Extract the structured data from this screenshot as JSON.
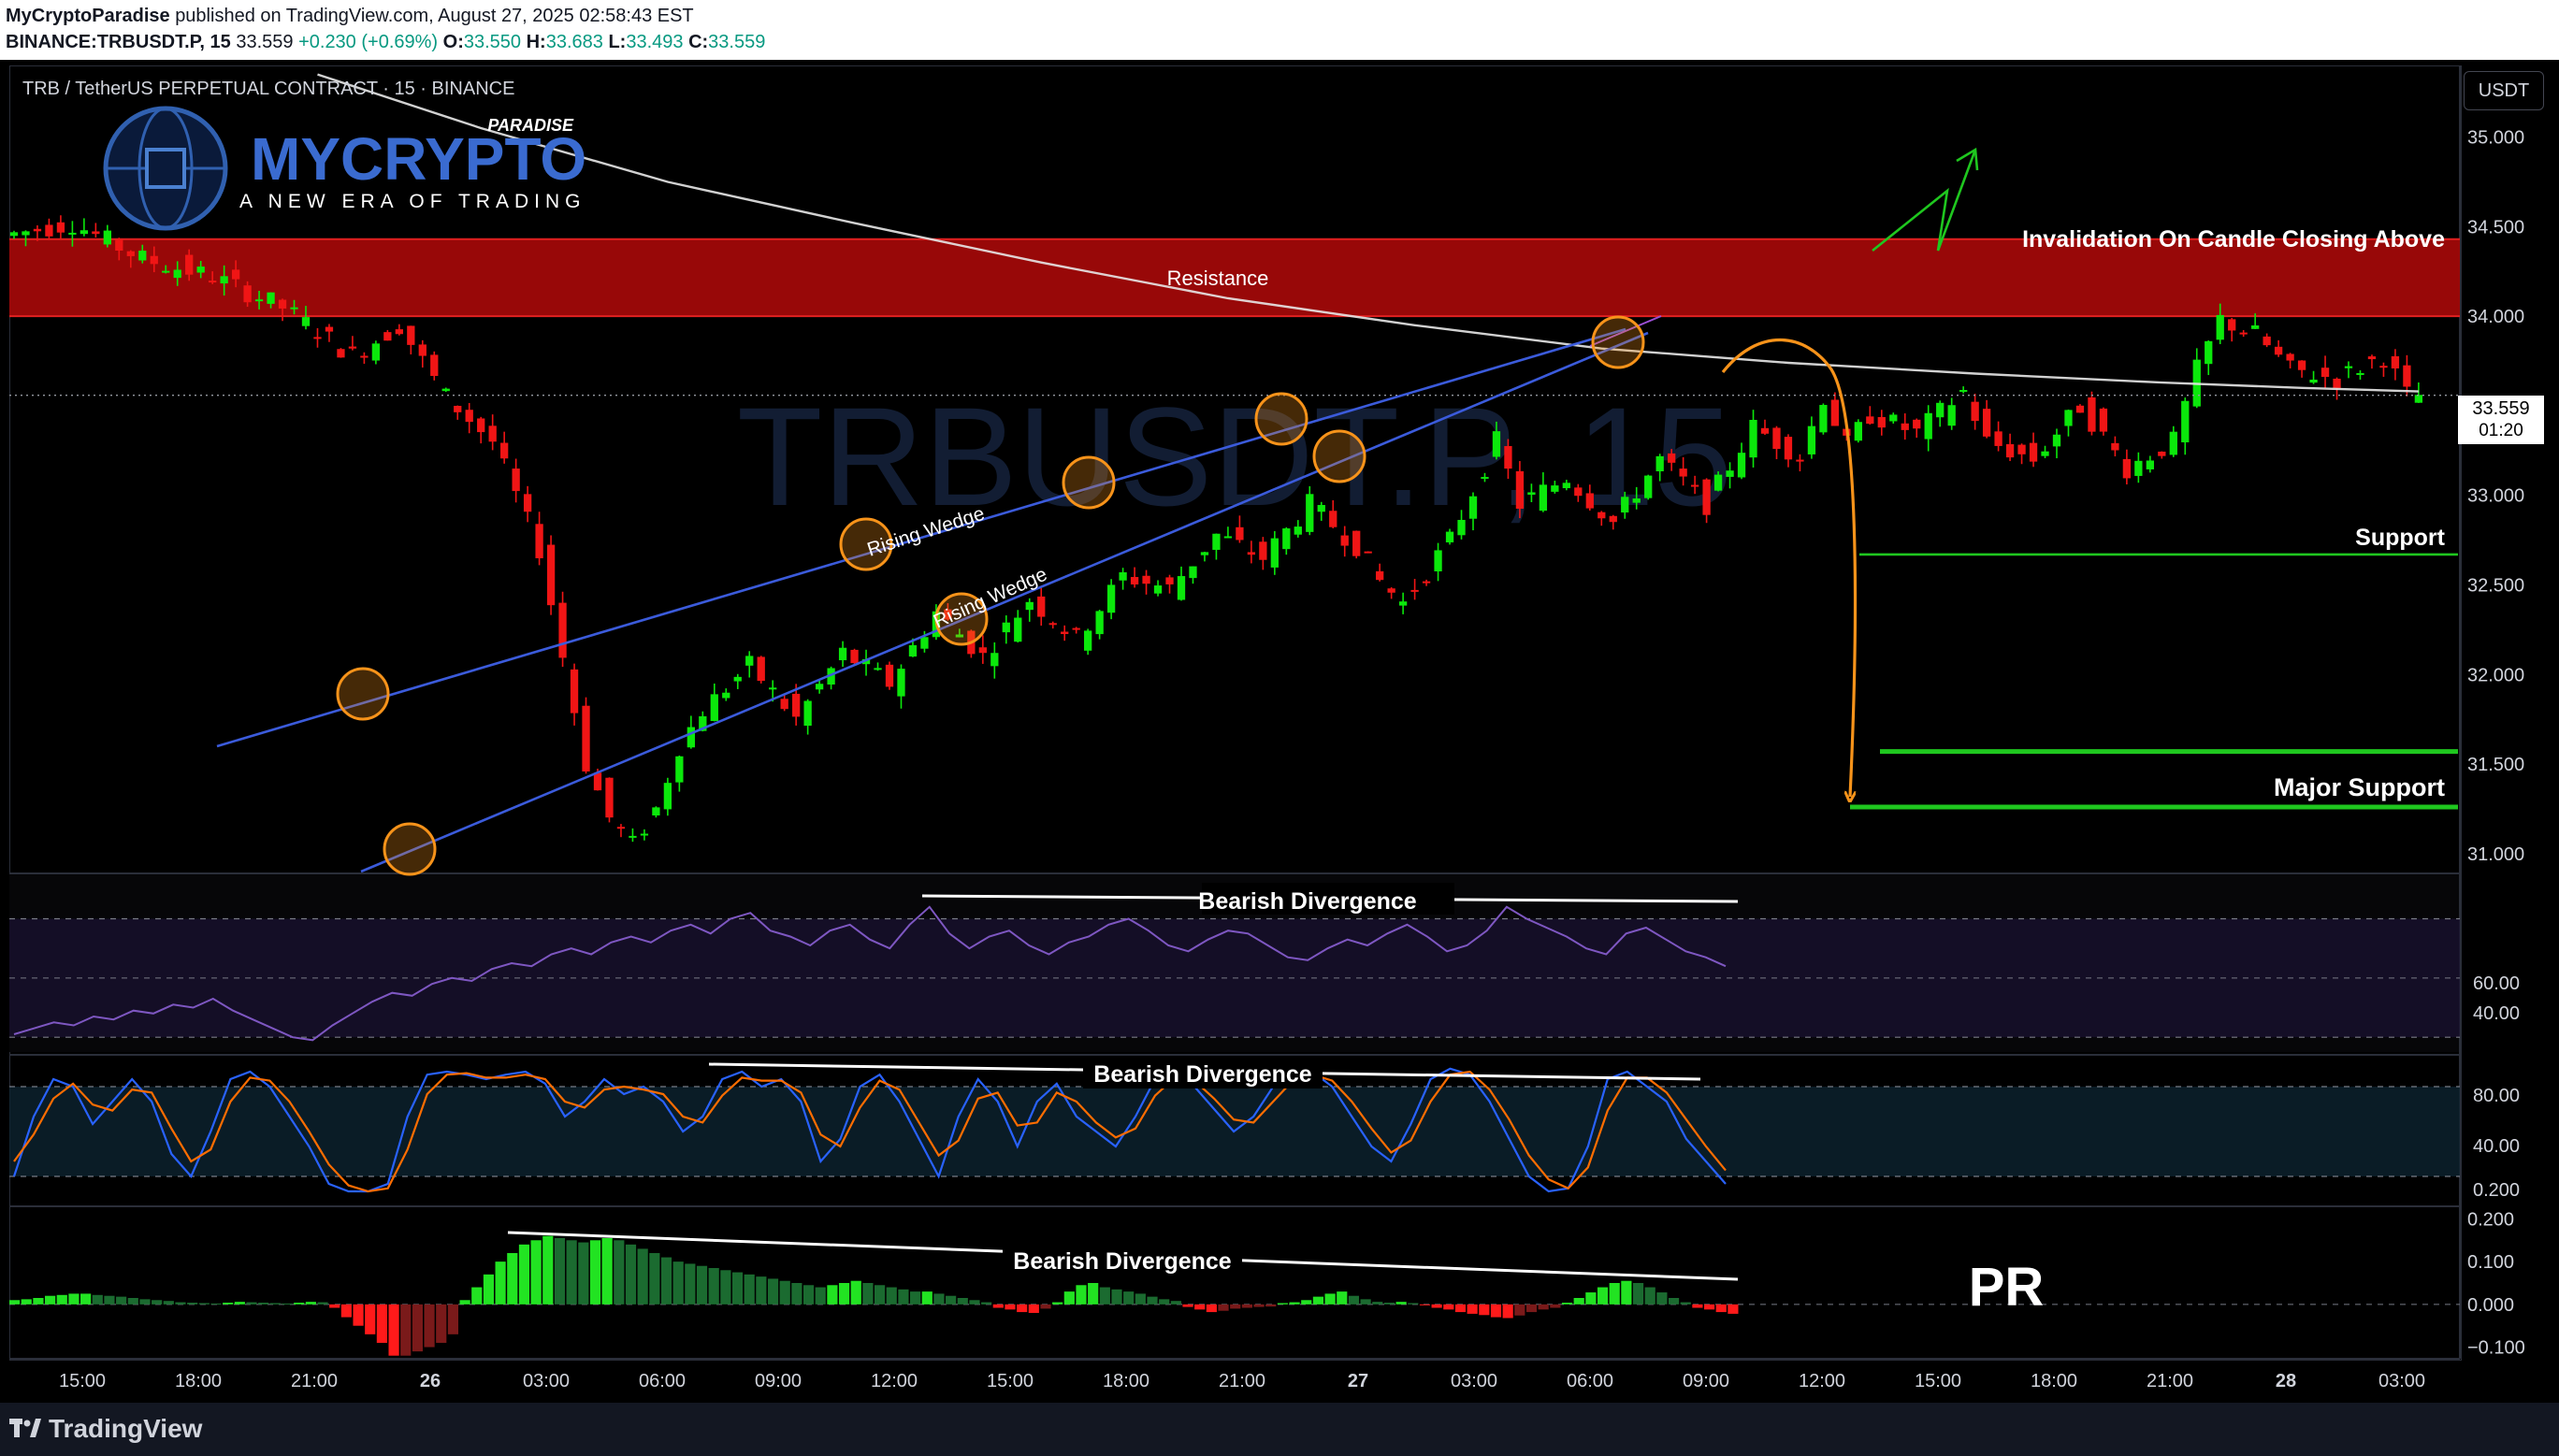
{
  "header": {
    "publisher": "MyCryptoParadise",
    "published_text": "published on TradingView.com, August 27, 2025 02:58:43 EST",
    "ticker": "BINANCE:TRBUSDT.P, 15",
    "last": "33.559",
    "change": "+0.230 (+0.69%)",
    "open_label": "O:",
    "open": "33.550",
    "high_label": "H:",
    "high": "33.683",
    "low_label": "L:",
    "low": "33.493",
    "close_label": "C:",
    "close": "33.559"
  },
  "symbol_title": "TRB / TetherUS PERPETUAL CONTRACT · 15 · BINANCE",
  "watermark": "TRBUSDT.P, 15",
  "currency_button": "USDT",
  "price_tag": {
    "price": "33.559",
    "countdown": "01:20"
  },
  "branding": {
    "logo_top": "PARADISE",
    "logo_main": "MYCRYPTO",
    "logo_tagline": "A NEW ERA OF TRADING",
    "corner_mark": "PR",
    "platform": "TradingView"
  },
  "colors": {
    "bullish": "#0be80b",
    "bearish": "#f01515",
    "resistance_zone": "#a00808",
    "trendline": "#3b5bdb",
    "projection_arrow": "#f7931a",
    "touch_circle": "#f7931a",
    "moving_average": "#e8e8e8",
    "support_line": "#1fc71f",
    "rsi": "#7e57c2",
    "stoch_k": "#2962ff",
    "stoch_d": "#ff6d00"
  },
  "chart_data": {
    "type": "candlestick",
    "instrument": "TRBUSDT.P",
    "timeframe": "15",
    "x_tick_labels": [
      "15:00",
      "18:00",
      "21:00",
      "26",
      "03:00",
      "06:00",
      "09:00",
      "12:00",
      "15:00",
      "18:00",
      "21:00",
      "27",
      "03:00",
      "06:00",
      "09:00",
      "12:00",
      "15:00",
      "18:00",
      "21:00",
      "28",
      "03:00"
    ],
    "y_tick_labels": [
      "35.000",
      "34.500",
      "34.000",
      "33.500",
      "33.000",
      "32.500",
      "32.000",
      "31.500",
      "31.000"
    ],
    "ylim": [
      30.9,
      35.4
    ],
    "grid": false,
    "ohlc_path": [
      [
        0,
        34.45
      ],
      [
        6,
        34.52
      ],
      [
        12,
        34.32
      ],
      [
        18,
        34.22
      ],
      [
        24,
        34.05
      ],
      [
        30,
        33.78
      ],
      [
        34,
        33.95
      ],
      [
        38,
        33.55
      ],
      [
        42,
        33.3
      ],
      [
        46,
        32.7
      ],
      [
        48,
        32.1
      ],
      [
        50,
        31.5
      ],
      [
        52,
        31.2
      ],
      [
        54,
        31.05
      ],
      [
        56,
        31.25
      ],
      [
        58,
        31.6
      ],
      [
        60,
        31.8
      ],
      [
        64,
        32.05
      ],
      [
        68,
        31.75
      ],
      [
        72,
        32.12
      ],
      [
        76,
        31.95
      ],
      [
        80,
        32.35
      ],
      [
        84,
        32.1
      ],
      [
        88,
        32.42
      ],
      [
        92,
        32.2
      ],
      [
        96,
        32.55
      ],
      [
        100,
        32.48
      ],
      [
        104,
        32.78
      ],
      [
        108,
        32.65
      ],
      [
        112,
        32.95
      ],
      [
        116,
        32.72
      ],
      [
        118,
        32.52
      ],
      [
        120,
        32.4
      ],
      [
        124,
        32.75
      ],
      [
        128,
        33.3
      ],
      [
        130,
        32.95
      ],
      [
        134,
        33.1
      ],
      [
        138,
        32.85
      ],
      [
        142,
        33.2
      ],
      [
        146,
        32.95
      ],
      [
        150,
        33.38
      ],
      [
        154,
        33.22
      ],
      [
        156,
        33.55
      ],
      [
        158,
        33.28
      ],
      [
        160,
        33.45
      ],
      [
        164,
        33.35
      ],
      [
        168,
        33.58
      ],
      [
        170,
        33.3
      ],
      [
        174,
        33.2
      ],
      [
        178,
        33.5
      ],
      [
        182,
        33.15
      ],
      [
        186,
        33.3
      ],
      [
        188,
        33.7
      ],
      [
        190,
        33.98
      ],
      [
        193,
        33.9
      ],
      [
        196,
        33.7
      ],
      [
        200,
        33.65
      ],
      [
        204,
        33.78
      ],
      [
        206,
        33.56
      ]
    ],
    "moving_average_path": [
      [
        26,
        35.35
      ],
      [
        40,
        35.05
      ],
      [
        56,
        34.75
      ],
      [
        72,
        34.52
      ],
      [
        88,
        34.3
      ],
      [
        104,
        34.1
      ],
      [
        120,
        33.95
      ],
      [
        136,
        33.82
      ],
      [
        152,
        33.74
      ],
      [
        168,
        33.68
      ],
      [
        184,
        33.63
      ],
      [
        196,
        33.6
      ],
      [
        206,
        33.58
      ]
    ],
    "annotations": {
      "resistance_label": "Resistance",
      "resistance_zone": [
        34.0,
        34.43
      ],
      "invalidation_label": "Invalidation On Candle Closing Above",
      "support_label": "Support",
      "support_level": 32.67,
      "major_support_label": "Major Support",
      "major_support_levels": [
        31.57,
        31.26
      ],
      "pattern_labels": [
        "Rising Wedge",
        "Rising Wedge"
      ]
    },
    "indicators": [
      {
        "name": "RSI",
        "y_tick_labels": [
          "60.00",
          "40.00"
        ],
        "ylim": [
          25,
          85
        ],
        "bands": [
          70,
          30
        ],
        "values": [
          31,
          33,
          35,
          34,
          37,
          36,
          39,
          38,
          41,
          40,
          43,
          39,
          36,
          33,
          30,
          29,
          34,
          38,
          42,
          45,
          44,
          48,
          50,
          49,
          53,
          55,
          54,
          58,
          60,
          58,
          62,
          64,
          62,
          66,
          68,
          65,
          70,
          72,
          66,
          64,
          61,
          66,
          68,
          63,
          60,
          68,
          74,
          65,
          60,
          64,
          66,
          61,
          58,
          62,
          64,
          68,
          70,
          66,
          61,
          59,
          63,
          66,
          65,
          61,
          57,
          56,
          60,
          63,
          61,
          65,
          68,
          64,
          59,
          61,
          66,
          74,
          70,
          67,
          64,
          60,
          58,
          65,
          67,
          63,
          59,
          57,
          54
        ]
      },
      {
        "name": "Stochastic RSI",
        "y_tick_labels": [
          "80.00",
          "40.00",
          "0.200"
        ],
        "ylim": [
          0,
          100
        ],
        "bands": [
          80,
          20
        ],
        "k_values": [
          20,
          60,
          85,
          80,
          55,
          70,
          85,
          70,
          35,
          20,
          50,
          85,
          90,
          80,
          60,
          40,
          15,
          10,
          10,
          15,
          60,
          88,
          90,
          88,
          85,
          88,
          90,
          82,
          60,
          70,
          85,
          75,
          80,
          70,
          50,
          60,
          85,
          90,
          80,
          85,
          70,
          30,
          45,
          80,
          88,
          70,
          45,
          20,
          60,
          85,
          70,
          40,
          70,
          82,
          60,
          50,
          40,
          60,
          85,
          88,
          80,
          65,
          50,
          60,
          80,
          88,
          90,
          80,
          60,
          40,
          30,
          55,
          85,
          92,
          88,
          70,
          45,
          20,
          10,
          12,
          40,
          85,
          90,
          80,
          70,
          45,
          30,
          15
        ],
        "d_values": [
          30,
          48,
          72,
          82,
          68,
          64,
          78,
          76,
          52,
          30,
          38,
          70,
          86,
          84,
          70,
          50,
          28,
          14,
          10,
          12,
          38,
          75,
          88,
          89,
          86,
          86,
          88,
          85,
          70,
          66,
          78,
          80,
          78,
          75,
          60,
          56,
          74,
          86,
          84,
          84,
          76,
          48,
          40,
          66,
          84,
          78,
          56,
          34,
          44,
          72,
          76,
          54,
          56,
          76,
          70,
          56,
          46,
          52,
          74,
          86,
          84,
          72,
          58,
          56,
          70,
          84,
          88,
          84,
          70,
          52,
          36,
          44,
          70,
          88,
          90,
          78,
          58,
          34,
          18,
          12,
          26,
          64,
          86,
          86,
          76,
          58,
          40,
          24
        ]
      },
      {
        "name": "MACD Histogram",
        "y_tick_labels": [
          "0.200",
          "0.100",
          "0.000",
          "−0.100"
        ],
        "ylim": [
          -0.125,
          0.225
        ],
        "values": [
          0.01,
          0.012,
          0.015,
          0.02,
          0.022,
          0.025,
          0.025,
          0.022,
          0.02,
          0.018,
          0.015,
          0.012,
          0.01,
          0.008,
          0.005,
          0.004,
          0.003,
          0.002,
          0.004,
          0.006,
          0.005,
          0.004,
          0.003,
          0.002,
          0.004,
          0.006,
          0.005,
          -0.008,
          -0.03,
          -0.05,
          -0.07,
          -0.09,
          -0.12,
          -0.12,
          -0.11,
          -0.1,
          -0.09,
          -0.07,
          0.01,
          0.04,
          0.07,
          0.1,
          0.12,
          0.14,
          0.15,
          0.16,
          0.155,
          0.15,
          0.145,
          0.15,
          0.155,
          0.15,
          0.14,
          0.13,
          0.12,
          0.11,
          0.1,
          0.095,
          0.09,
          0.085,
          0.08,
          0.075,
          0.07,
          0.065,
          0.06,
          0.055,
          0.05,
          0.045,
          0.04,
          0.045,
          0.05,
          0.055,
          0.05,
          0.045,
          0.04,
          0.035,
          0.03,
          0.03,
          0.025,
          0.02,
          0.015,
          0.01,
          0.005,
          -0.008,
          -0.012,
          -0.018,
          -0.02,
          -0.01,
          0.005,
          0.03,
          0.045,
          0.05,
          0.04,
          0.035,
          0.03,
          0.025,
          0.018,
          0.012,
          0.008,
          -0.006,
          -0.012,
          -0.018,
          -0.015,
          -0.01,
          -0.008,
          -0.006,
          -0.005,
          0.003,
          0.005,
          0.01,
          0.018,
          0.025,
          0.03,
          0.02,
          0.012,
          0.006,
          0.004,
          0.006,
          0.003,
          -0.002,
          -0.008,
          -0.012,
          -0.018,
          -0.022,
          -0.025,
          -0.03,
          -0.032,
          -0.026,
          -0.018,
          -0.012,
          -0.008,
          0.004,
          0.015,
          0.028,
          0.04,
          0.05,
          0.055,
          0.05,
          0.04,
          0.028,
          0.015,
          0.005,
          -0.008,
          -0.012,
          -0.018,
          -0.022
        ]
      }
    ],
    "divergence_labels": [
      "Bearish Divergence",
      "Bearish Divergence",
      "Bearish Divergence"
    ]
  }
}
